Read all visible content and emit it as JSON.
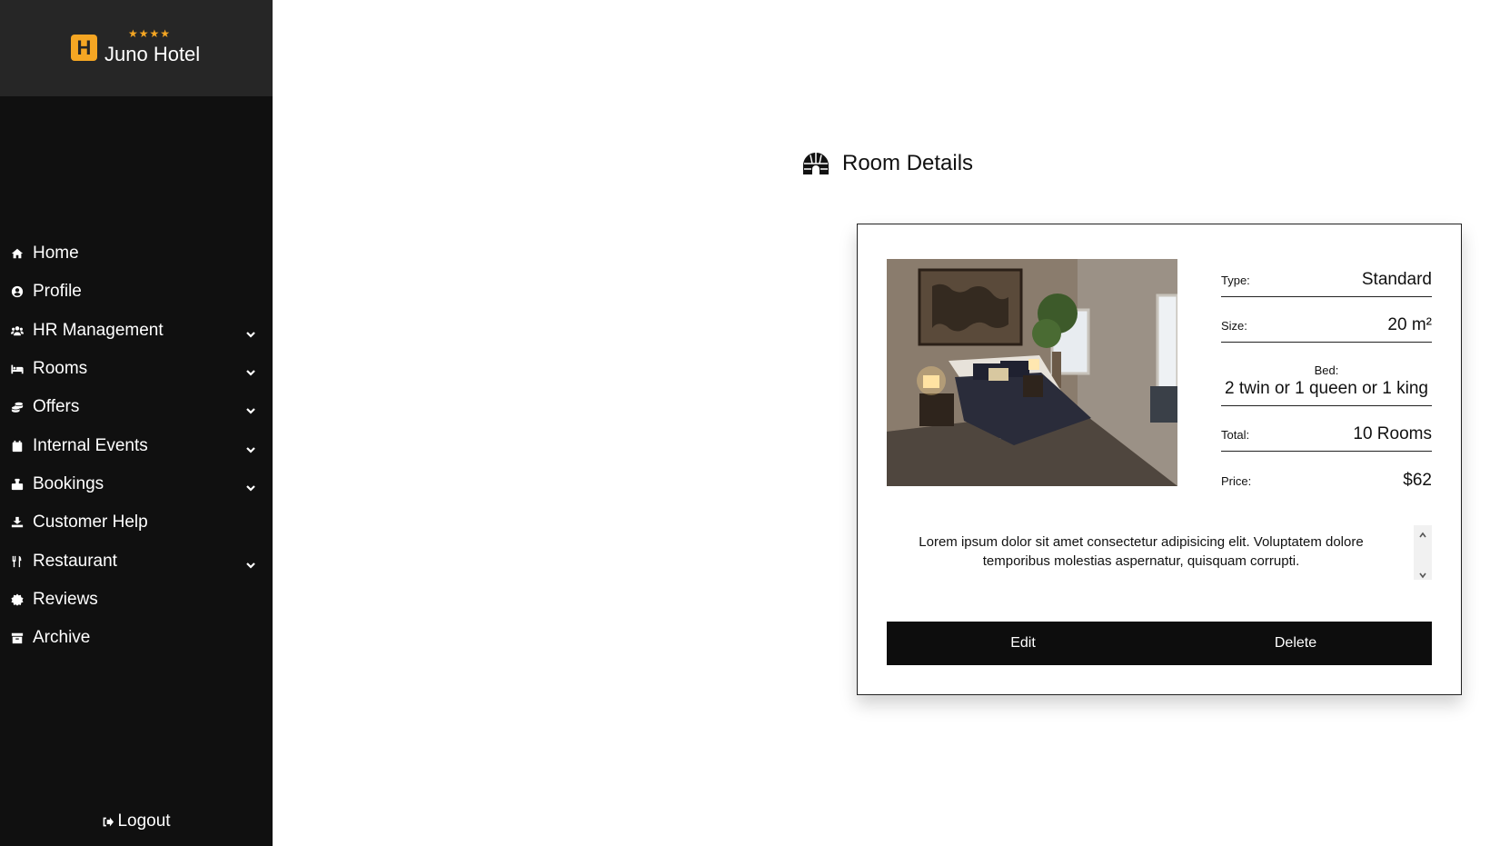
{
  "brand": {
    "name": "Juno Hotel",
    "logo_letter": "H",
    "stars": "★★★★"
  },
  "sidebar": {
    "items": [
      {
        "label": "Home",
        "icon": "home-icon",
        "has_submenu": false
      },
      {
        "label": "Profile",
        "icon": "profile-icon",
        "has_submenu": false
      },
      {
        "label": "HR Management",
        "icon": "users-icon",
        "has_submenu": true
      },
      {
        "label": "Rooms",
        "icon": "bed-icon",
        "has_submenu": true
      },
      {
        "label": "Offers",
        "icon": "coins-icon",
        "has_submenu": true
      },
      {
        "label": "Internal Events",
        "icon": "calendar-icon",
        "has_submenu": true
      },
      {
        "label": "Bookings",
        "icon": "luggage-icon",
        "has_submenu": true
      },
      {
        "label": "Customer Help",
        "icon": "help-hand-icon",
        "has_submenu": false
      },
      {
        "label": "Restaurant",
        "icon": "utensils-icon",
        "has_submenu": true
      },
      {
        "label": "Reviews",
        "icon": "badge-icon",
        "has_submenu": false
      },
      {
        "label": "Archive",
        "icon": "archive-icon",
        "has_submenu": false
      }
    ],
    "logout_label": "Logout"
  },
  "page": {
    "title": "Room Details",
    "title_icon": "igloo-icon"
  },
  "room": {
    "type_label": "Type:",
    "type_value": "Standard",
    "size_label": "Size:",
    "size_value": "20 m²",
    "bed_label": "Bed:",
    "bed_value": "2 twin or 1 queen or 1 king",
    "total_label": "Total:",
    "total_value": "10 Rooms",
    "price_label": "Price:",
    "price_value": "$62",
    "description": "Lorem ipsum dolor sit amet consectetur adipisicing elit. Voluptatem dolore temporibus molestias aspernatur, quisquam corrupti."
  },
  "actions": {
    "edit_label": "Edit",
    "delete_label": "Delete"
  },
  "colors": {
    "sidebar_bg": "#101010",
    "brand_bg": "#262626",
    "accent": "#f5a623",
    "button_bg": "#0d0d0d"
  }
}
